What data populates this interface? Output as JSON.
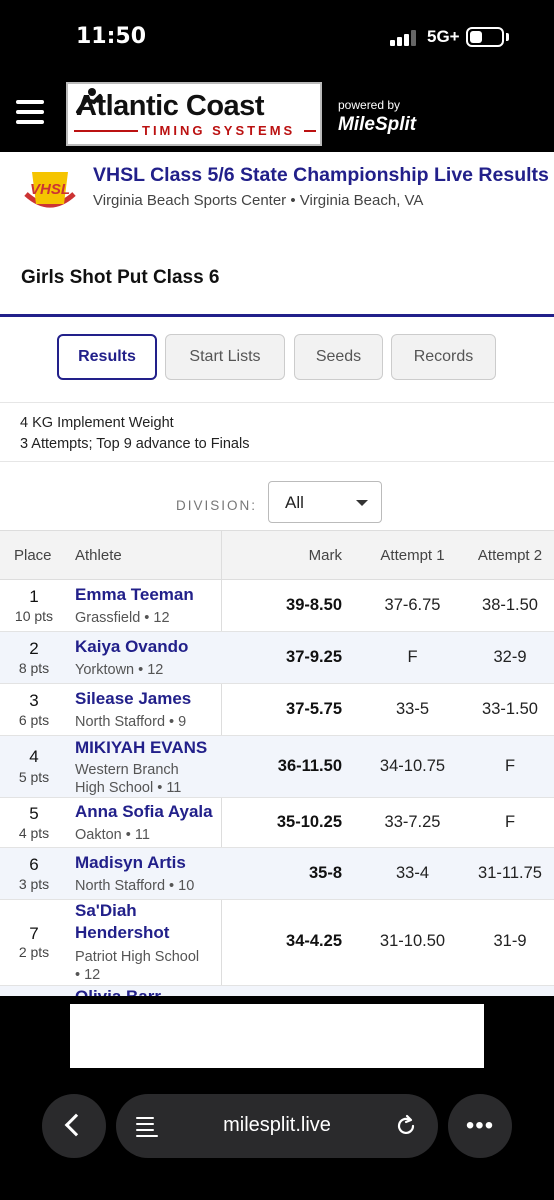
{
  "status_bar": {
    "time": "11:50",
    "network": "5G+"
  },
  "header": {
    "logo_main": "Atlantic Coast",
    "logo_sub": "TIMING SYSTEMS",
    "powered_by": "powered by",
    "brand": "MileSplit",
    "menu_icon": "hamburger-icon"
  },
  "meet": {
    "logo_text": "VHSL",
    "title": "VHSL Class 5/6 State Championship Live Results",
    "location": "Virginia Beach Sports Center • Virginia Beach, VA"
  },
  "event": {
    "title": "Girls Shot Put Class 6"
  },
  "tabs": [
    {
      "label": "Results",
      "active": true
    },
    {
      "label": "Start Lists",
      "active": false
    },
    {
      "label": "Seeds",
      "active": false
    },
    {
      "label": "Records",
      "active": false
    }
  ],
  "info": {
    "line1": "4 KG Implement Weight",
    "line2": "3 Attempts; Top 9 advance to Finals"
  },
  "division": {
    "label": "DIVISION:",
    "value": "All"
  },
  "table": {
    "headers": {
      "place": "Place",
      "athlete": "Athlete",
      "mark": "Mark",
      "attempt1": "Attempt 1",
      "attempt2": "Attempt 2"
    },
    "rows": [
      {
        "place": "1",
        "pts": "10 pts",
        "name": "Emma Teeman",
        "team": "Grassfield • 12",
        "mark": "39-8.50",
        "a1": "37-6.75",
        "a2": "38-1.50"
      },
      {
        "place": "2",
        "pts": "8 pts",
        "name": "Kaiya Ovando",
        "team": "Yorktown • 12",
        "mark": "37-9.25",
        "a1": "F",
        "a2": "32-9"
      },
      {
        "place": "3",
        "pts": "6 pts",
        "name": "Silease James",
        "team": "North Stafford • 9",
        "mark": "37-5.75",
        "a1": "33-5",
        "a2": "33-1.50"
      },
      {
        "place": "4",
        "pts": "5 pts",
        "name": "MIKIYAH EVANS",
        "team_line1": "Western Branch",
        "team_line2": "High School • 11",
        "mark": "36-11.50",
        "a1": "34-10.75",
        "a2": "F"
      },
      {
        "place": "5",
        "pts": "4 pts",
        "name": "Anna Sofia Ayala",
        "team": "Oakton • 11",
        "mark": "35-10.25",
        "a1": "33-7.25",
        "a2": "F"
      },
      {
        "place": "6",
        "pts": "3 pts",
        "name": "Madisyn Artis",
        "team": "North Stafford • 10",
        "mark": "35-8",
        "a1": "33-4",
        "a2": "31-11.75"
      },
      {
        "place": "7",
        "pts": "2 pts",
        "name_line1": "Sa'Diah",
        "name_line2": "Hendershot",
        "team_line1": "Patriot High School",
        "team_line2": "• 12",
        "mark": "34-4.25",
        "a1": "31-10.50",
        "a2": "31-9"
      },
      {
        "name": "Olivia Barr"
      }
    ]
  },
  "browser": {
    "url": "milesplit.live"
  },
  "colors": {
    "brand_navy": "#22208a",
    "logo_red": "#b11",
    "row_alt": "#f2f5fb"
  }
}
